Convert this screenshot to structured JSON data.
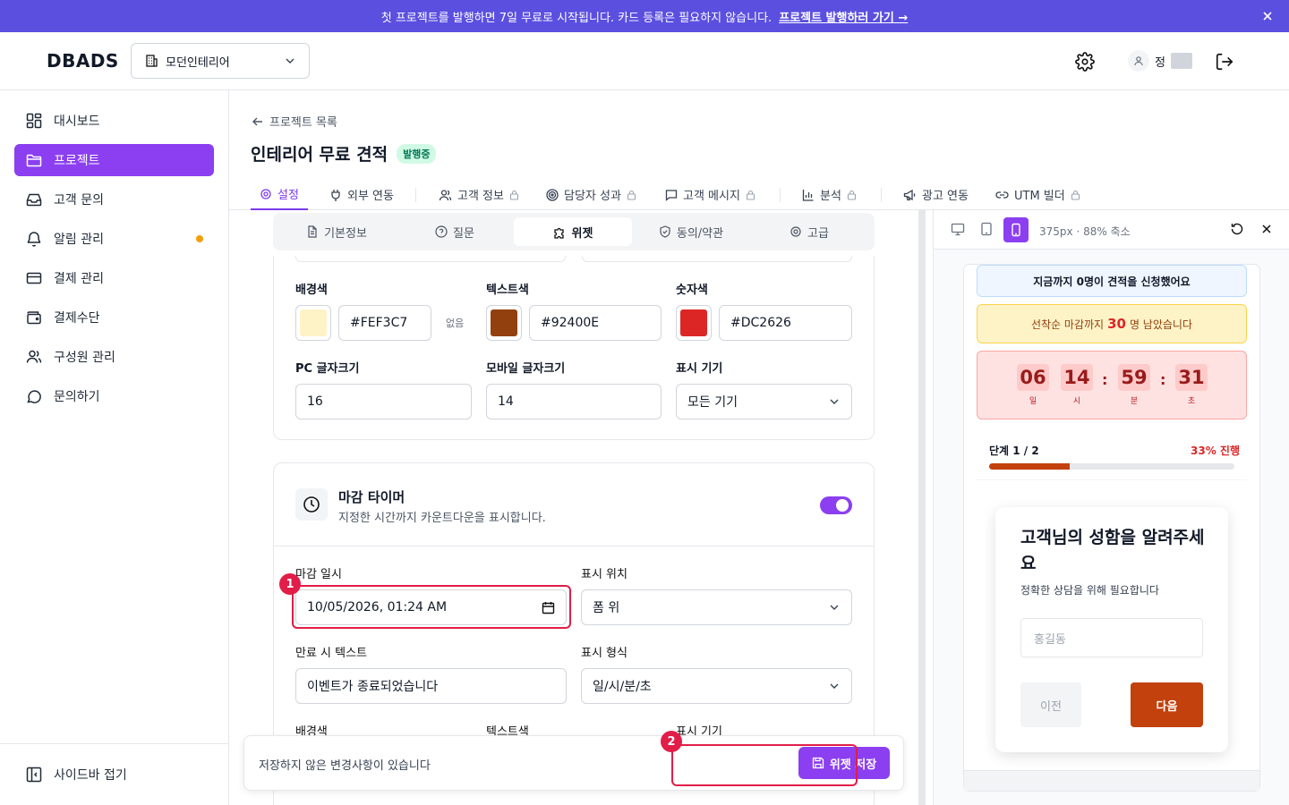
{
  "banner": {
    "text": "첫 프로젝트를 발행하면 7일 무료로 시작됩니다. 카드 등록은 필요하지 않습니다.",
    "link": "프로젝트 발행하러 가기 →"
  },
  "header": {
    "logo": "DBADS",
    "company": "모던인테리어",
    "user_initial": "정"
  },
  "sidebar": {
    "items": [
      {
        "label": "대시보드",
        "icon": "dashboard-icon"
      },
      {
        "label": "프로젝트",
        "icon": "folder-icon",
        "active": true
      },
      {
        "label": "고객 문의",
        "icon": "inbox-icon"
      },
      {
        "label": "알림 관리",
        "icon": "bell-icon"
      },
      {
        "label": "결제 관리",
        "icon": "card-icon"
      },
      {
        "label": "결제수단",
        "icon": "wallet-icon"
      },
      {
        "label": "구성원 관리",
        "icon": "users-icon"
      },
      {
        "label": "문의하기",
        "icon": "chat-icon"
      }
    ],
    "collapse": "사이드바 접기"
  },
  "page": {
    "back": "프로젝트 목록",
    "title": "인테리어 무료 견적",
    "status": "발행중"
  },
  "tabs": [
    "설정",
    "외부 연동",
    "고객 정보",
    "담당자 성과",
    "고객 메시지",
    "분석",
    "광고 연동",
    "UTM 빌더"
  ],
  "subtabs": [
    "기본정보",
    "질문",
    "위젯",
    "동의/약관",
    "고급"
  ],
  "style_section": {
    "bg_label": "배경색",
    "bg_value": "#FEF3C7",
    "none_label": "없음",
    "text_label": "텍스트색",
    "text_value": "#92400E",
    "num_label": "숫자색",
    "num_value": "#DC2626",
    "pc_font_label": "PC 글자크기",
    "pc_font_value": "16",
    "mobile_font_label": "모바일 글자크기",
    "mobile_font_value": "14",
    "device_label": "표시 기기",
    "device_value": "모든 기기"
  },
  "timer_section": {
    "title": "마감 타이머",
    "desc": "지정한 시간까지 카운트다운을 표시합니다.",
    "enabled": true,
    "deadline_label": "마감 일시",
    "deadline_value": "10/05/2026, 01:24 AM",
    "position_label": "표시 위치",
    "position_value": "폼 위",
    "expire_label": "만료 시 텍스트",
    "expire_value": "이벤트가 종료되었습니다",
    "format_label": "표시 형식",
    "format_value": "일/시/분/초",
    "bg_label": "배경색",
    "text_label": "텍스트색",
    "device_label": "표시 기기"
  },
  "savebar": {
    "message": "저장하지 않은 변경사항이 있습니다",
    "button": "위젯 저장"
  },
  "markers": [
    "1",
    "2"
  ],
  "preview": {
    "info": "375px · 88% 축소",
    "count_text": "지금까지 0명이 견적을 신청했어요",
    "urgent_pre": "선착순 마감까지",
    "urgent_num": "30",
    "urgent_post": "명 남았습니다",
    "timer": [
      {
        "v": "06",
        "u": "일"
      },
      {
        "v": "14",
        "u": "시"
      },
      {
        "v": "59",
        "u": "분"
      },
      {
        "v": "31",
        "u": "초"
      }
    ],
    "step": "단계 1 / 2",
    "percent_label": "33% 진행",
    "progress": 0.33,
    "question": "고객님의 성함을 알려주세요",
    "question_sub": "정확한 상담을 위해 필요합니다",
    "name_placeholder": "홍길동",
    "prev": "이전",
    "next": "다음"
  },
  "colors": {
    "accent": "#8B3FF0",
    "banner": "#5B4FE0",
    "swatch_bg": "#FEF3C7",
    "swatch_text": "#92400E",
    "swatch_num": "#DC2626"
  }
}
